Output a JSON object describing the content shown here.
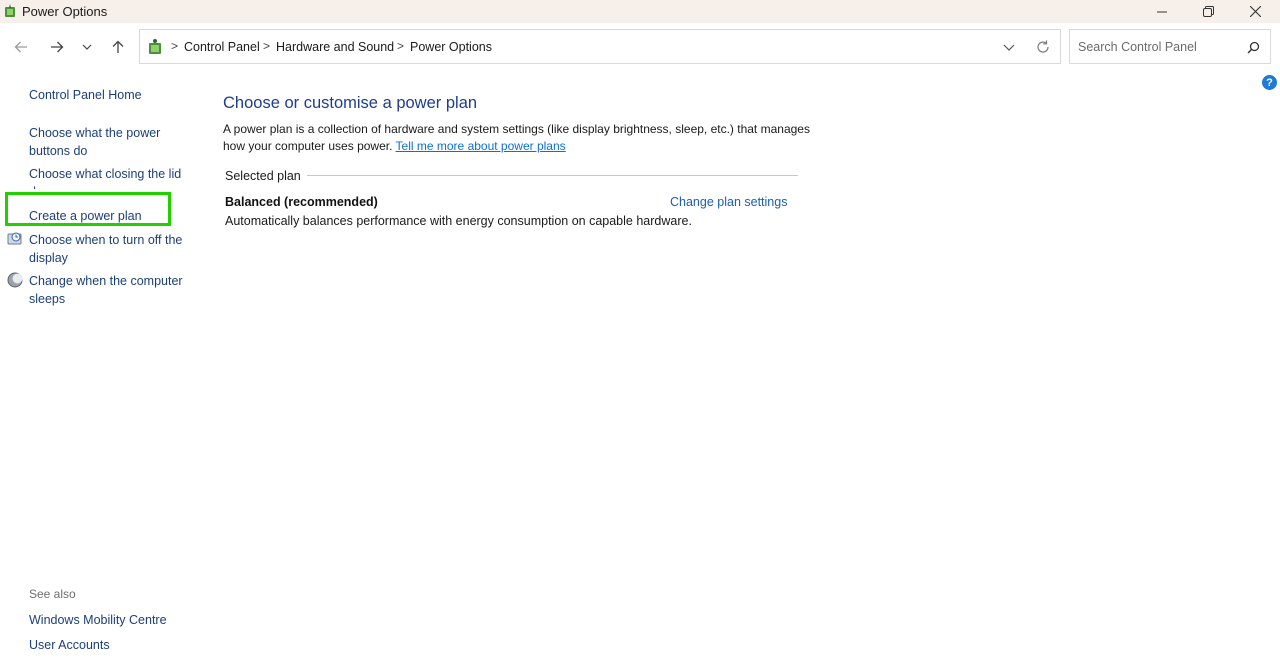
{
  "window": {
    "title": "Power Options",
    "controls": [
      "minimize-icon",
      "maximize-icon",
      "close-icon"
    ]
  },
  "nav": {
    "breadcrumb": [
      "Control Panel",
      "Hardware and Sound",
      "Power Options"
    ],
    "search_placeholder": "Search Control Panel",
    "help_label": "?"
  },
  "sidebar": {
    "home": "Control Panel Home",
    "tasks": [
      {
        "label_line1": "Choose what the power",
        "label_line2": "buttons do",
        "icon": null
      },
      {
        "label_line1": "Choose what closing the lid",
        "label_line2": "does",
        "icon": null
      },
      {
        "label_line1": "Create a power plan",
        "label_line2": "",
        "icon": null,
        "highlighted": true
      },
      {
        "label_line1": "Choose when to turn off the",
        "label_line2": "display",
        "icon": "monitor-clock-icon"
      },
      {
        "label_line1": "Change when the computer",
        "label_line2": "sleeps",
        "icon": "moon-sleep-icon"
      }
    ],
    "see_also_label": "See also",
    "see_also": [
      "Windows Mobility Centre",
      "User Accounts"
    ]
  },
  "main": {
    "title": "Choose or customise a power plan",
    "description_line1": "A power plan is a collection of hardware and system settings (like display brightness, sleep, etc.) that manages",
    "description_line2": "how your computer uses power.",
    "learn_more_link": "Tell me more about power plans",
    "selected_plan_label": "Selected plan",
    "plan": {
      "name": "Balanced (recommended)",
      "description": "Automatically balances performance with energy consumption on capable hardware.",
      "change_link": "Change plan settings"
    }
  },
  "colors": {
    "title_blue": "#1e3d8f",
    "link_blue": "#1c3f78",
    "highlight_green": "#22d000",
    "titlebar_bg": "#f7efe9"
  }
}
